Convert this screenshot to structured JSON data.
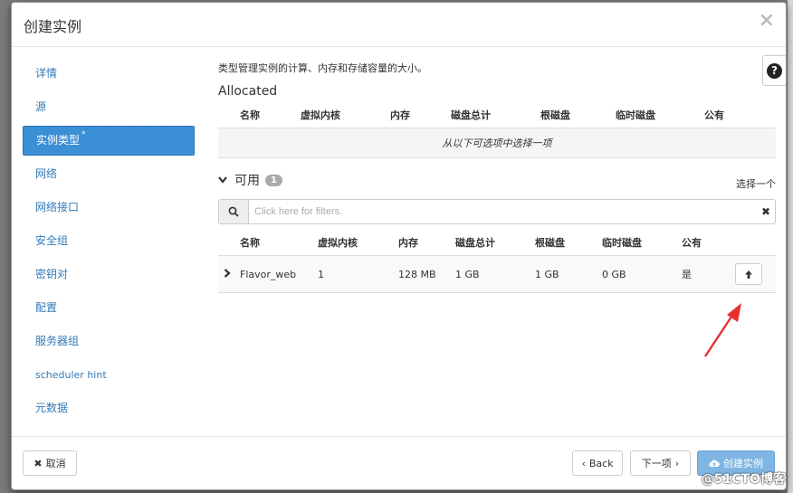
{
  "modal": {
    "title": "创建实例",
    "close": "×"
  },
  "sidebar": {
    "items": [
      {
        "label": "详情"
      },
      {
        "label": "源"
      },
      {
        "label": "实例类型",
        "required": "*"
      },
      {
        "label": "网络"
      },
      {
        "label": "网络接口"
      },
      {
        "label": "安全组"
      },
      {
        "label": "密钥对"
      },
      {
        "label": "配置"
      },
      {
        "label": "服务器组"
      },
      {
        "label": "scheduler hint"
      },
      {
        "label": "元数据"
      }
    ]
  },
  "content": {
    "description": "类型管理实例的计算、内存和存储容量的大小。",
    "help": "?",
    "allocated": {
      "title": "Allocated",
      "columns": [
        "名称",
        "虚拟内核",
        "内存",
        "磁盘总计",
        "根磁盘",
        "临时磁盘",
        "公有"
      ],
      "empty_message": "从以下可选项中选择一项"
    },
    "available": {
      "title": "可用",
      "count": "1",
      "select_hint": "选择一个",
      "search_placeholder": "Click here for filters.",
      "columns": [
        "名称",
        "虚拟内核",
        "内存",
        "磁盘总计",
        "根磁盘",
        "临时磁盘",
        "公有"
      ],
      "rows": [
        {
          "name": "Flavor_web",
          "vcpus": "1",
          "ram": "128 MB",
          "total_disk": "1 GB",
          "root_disk": "1 GB",
          "ephemeral_disk": "0 GB",
          "public": "是"
        }
      ]
    }
  },
  "footer": {
    "cancel": "取消",
    "back": "Back",
    "next": "下一项",
    "create": "创建实例"
  },
  "watermark": "@51CTO博客",
  "colors": {
    "accent": "#3b8fd4",
    "annotation_arrow": "#e8312f"
  }
}
